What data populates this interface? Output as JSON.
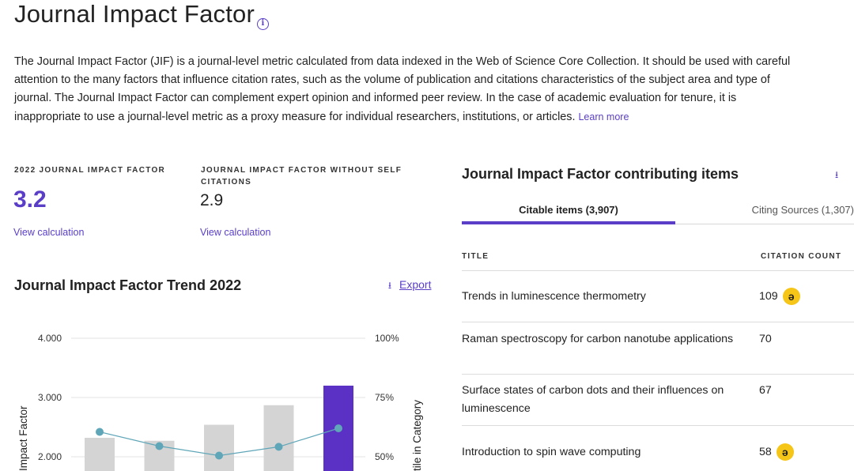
{
  "page": {
    "title": "Journal Impact Factor",
    "info_icon": "info-icon",
    "description": "The Journal Impact Factor (JIF) is a journal-level metric calculated from data indexed in the Web of Science Core Collection. It should be used with careful attention to the many factors that influence citation rates, such as the volume of publication and citations characteristics of the subject area and type of journal. The Journal Impact Factor can complement expert opinion and informed peer review. In the case of academic evaluation for tenure, it is inappropriate to use a journal-level metric as a proxy measure for individual researchers, institutions, or articles.",
    "learn_more": "Learn more"
  },
  "metrics": {
    "jif_label": "2022 JOURNAL IMPACT FACTOR",
    "jif_value": "3.2",
    "jif_link": "View calculation",
    "noself_label": "JOURNAL IMPACT FACTOR WITHOUT SELF CITATIONS",
    "noself_value": "2.9",
    "noself_link": "View calculation"
  },
  "trend": {
    "title": "Journal Impact Factor Trend 2022",
    "export_label": "Export",
    "export_icon": "download-icon"
  },
  "chart_data": {
    "type": "bar",
    "title": "Journal Impact Factor Trend 2022",
    "ylabel": "Impact Factor",
    "y2label": "tile in Category",
    "ylim": [
      0,
      4
    ],
    "y_ticks": [
      "4.000",
      "3.000",
      "2.000"
    ],
    "y2lim": [
      0,
      100
    ],
    "y2_ticks": [
      "100%",
      "75%",
      "50%"
    ],
    "series": [
      {
        "values": [
          2.32,
          2.27,
          2.54,
          2.87,
          3.2
        ],
        "kind": "bar",
        "colors": [
          "#d4d4d4",
          "#d4d4d4",
          "#d4d4d4",
          "#d4d4d4",
          "#5a30c5"
        ]
      },
      {
        "values": [
          60.5,
          54.5,
          50.5,
          54.2,
          62
        ],
        "kind": "line",
        "axis": "right",
        "color": "#5fa6b8"
      }
    ],
    "grid": true
  },
  "contrib": {
    "title": "Journal Impact Factor contributing items",
    "download_icon": "download-icon",
    "tab_citable": "Citable items (3,907)",
    "tab_citing": "Citing Sources (1,307)",
    "col_title": "TITLE",
    "col_count": "CITATION COUNT",
    "rows": [
      {
        "title": "Trends in luminescence thermometry",
        "count": "109",
        "open_access": true
      },
      {
        "title": "Raman spectroscopy for carbon nanotube applications",
        "count": "70",
        "open_access": false
      },
      {
        "title": "Surface states of carbon dots and their influences on luminescence",
        "count": "67",
        "open_access": false
      },
      {
        "title": "Introduction to spin wave computing",
        "count": "58",
        "open_access": true
      }
    ]
  },
  "colors": {
    "accent": "#5a3ec8",
    "bar_gray": "#d4d4d4",
    "line_teal": "#5fa6b8",
    "oa_yellow": "#f5c518"
  }
}
